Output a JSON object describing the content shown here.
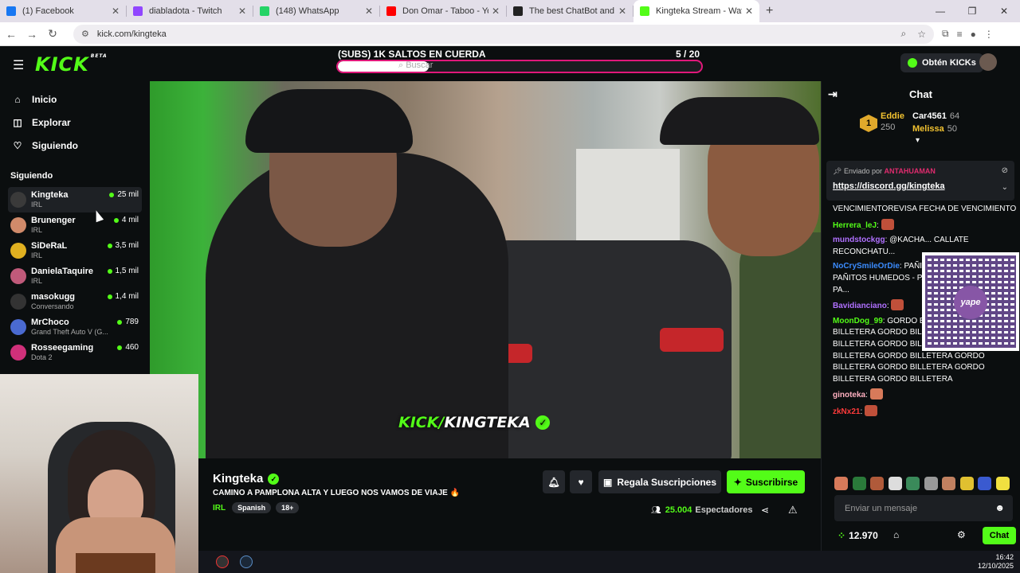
{
  "browser": {
    "tabs": [
      {
        "title": "(1) Facebook",
        "color": "#1877f2"
      },
      {
        "title": "diabladota - Twitch",
        "color": "#9146ff"
      },
      {
        "title": "(148) WhatsApp",
        "color": "#25d366"
      },
      {
        "title": "Don Omar - Taboo - YouTube",
        "color": "#ff0000"
      },
      {
        "title": "The best ChatBot and Widgets",
        "color": "#222222"
      },
      {
        "title": "Kingteka Stream - Watch Li",
        "color": "#53fc18"
      }
    ],
    "url": "kick.com/kingteka"
  },
  "header": {
    "logo": "KICK",
    "logo_badge": "BETA",
    "goal_title": "(SUBS) 1K SALTOS EN CUERDA",
    "goal_count": "5   / 20",
    "goal_progress": 0.25,
    "search_placeholder": "Buscar",
    "get_kicks": "Obtén KICKs"
  },
  "sidebar": {
    "nav": [
      {
        "label": "Inicio",
        "icon": "home-icon"
      },
      {
        "label": "Explorar",
        "icon": "compass-icon"
      },
      {
        "label": "Siguiendo",
        "icon": "heart-icon"
      }
    ],
    "following_title": "Siguiendo",
    "channels": [
      {
        "name": "Kingteka",
        "category": "IRL",
        "viewers": "25 mil",
        "color": "#3a3a3a"
      },
      {
        "name": "Brunenger",
        "category": "IRL",
        "viewers": "4 mil",
        "color": "#d08a6a"
      },
      {
        "name": "SiDeRaL",
        "category": "IRL",
        "viewers": "3,5 mil",
        "color": "#e0b020"
      },
      {
        "name": "DanielaTaquire",
        "category": "IRL",
        "viewers": "1,5 mil",
        "color": "#c05a7a"
      },
      {
        "name": "masokugg",
        "category": "Conversando",
        "viewers": "1,4 mil",
        "color": "#333333"
      },
      {
        "name": "MrChoco",
        "category": "Grand Theft Auto V (G...",
        "viewers": "789",
        "color": "#4a6ad0"
      },
      {
        "name": "Rosseegaming",
        "category": "Dota 2",
        "viewers": "460",
        "color": "#d0307a"
      }
    ]
  },
  "video": {
    "overlay_prefix": "KICK/",
    "overlay_name": "KINGTEKA"
  },
  "stream": {
    "name": "Kingteka",
    "title": "CAMINO A PAMPLONA ALTA Y LUEGO NOS VAMOS DE VIAJE 🔥",
    "category": "IRL",
    "tags": [
      "Spanish",
      "18+"
    ],
    "gift_label": "Regala Suscripciones",
    "subscribe_label": "Suscribirse",
    "viewers": "25.004",
    "viewers_label": "Espectadores"
  },
  "chat": {
    "title": "Chat",
    "leaderboard": {
      "first": {
        "rank": "1",
        "name": "Eddie",
        "points": "250"
      },
      "second": {
        "name": "Car4561",
        "points": "64"
      },
      "third": {
        "name": "Melissa",
        "points": "50"
      }
    },
    "pinned": {
      "by_label": "Enviado por",
      "by_user": "ANTAHUAMAN",
      "link": "https://discord.gg/kingteka"
    },
    "messages": [
      {
        "user": "",
        "text": "VENCIMIENTOREVISA FECHA DE VENCIMIENTO",
        "color": "#ffffff"
      },
      {
        "user": "Herrera_leJ",
        "text": "",
        "color": "#53fc18"
      },
      {
        "user": "mundstockgg",
        "text": "@KACHA... CALLATE RECONCHATU...",
        "color": "#b070ff"
      },
      {
        "user": "NoCrySmileOrDie",
        "text": "PAÑITOS HUMEDOS - PAÑITOS HUMEDOS - PAÑITOS HUMEDOS - PA...",
        "color": "#3b8cff"
      },
      {
        "user": "Bavidianciano",
        "text": "",
        "color": "#b070ff"
      },
      {
        "user": "MoonDog_99",
        "text": "GORDO BILLETERA GORDO BILLETERA GORDO BILLETERA GORDO BILLETERA GORDO BILLETERA GORDO BILLETERA GORDO BILLETERA GORDO BILLETERA GORDO BILLETERA GORDO BILLETERA GORDO BILLETERA",
        "color": "#53fc18"
      },
      {
        "user": "ginoteka",
        "text": "",
        "color": "#ffb0c0"
      },
      {
        "user": "zkNx21",
        "text": "",
        "color": "#ff3b3b"
      }
    ],
    "qr_label": "yape",
    "input_placeholder": "Enviar un mensaje",
    "balance": "12.970",
    "send_label": "Chat"
  },
  "taskbar": {
    "time": "16:42",
    "date": "12/10/2025"
  }
}
